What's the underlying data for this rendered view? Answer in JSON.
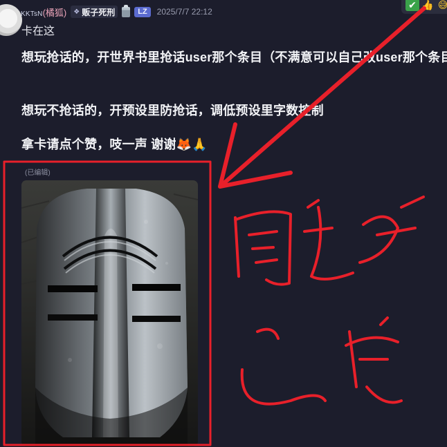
{
  "message": {
    "user": {
      "name_prefix": "KKTsN",
      "name_suffix": "(橘狐)",
      "role_tag": "贩子死刑",
      "role_icon": "sparkle-icon",
      "lz_badge": "LZ"
    },
    "timestamp": "2025/7/7 22:12",
    "line1": "卡在这",
    "paragraphs": [
      "想玩抢话的，开世界书里抢话user那个条目（不满意可以自己改user那个条目",
      "想玩不抢话的，开预设里防抢话，调低预设里字数控制",
      "拿卡请点个赞，吱一声 谢谢"
    ],
    "paragraph3_emojis": "🦊🙏",
    "edited_label": "(已编辑)"
  },
  "reactions": [
    {
      "icon": "check-icon",
      "glyph": "✔"
    },
    {
      "icon": "thumbs-up-icon",
      "glyph": "👍"
    },
    {
      "icon": "emoji-face-icon",
      "glyph": "😅"
    }
  ],
  "colors": {
    "background": "#1c1d2c",
    "annotation_red": "#e8202a",
    "lz_badge": "#5b6bd0",
    "username_suffix": "#e9a3b8"
  }
}
